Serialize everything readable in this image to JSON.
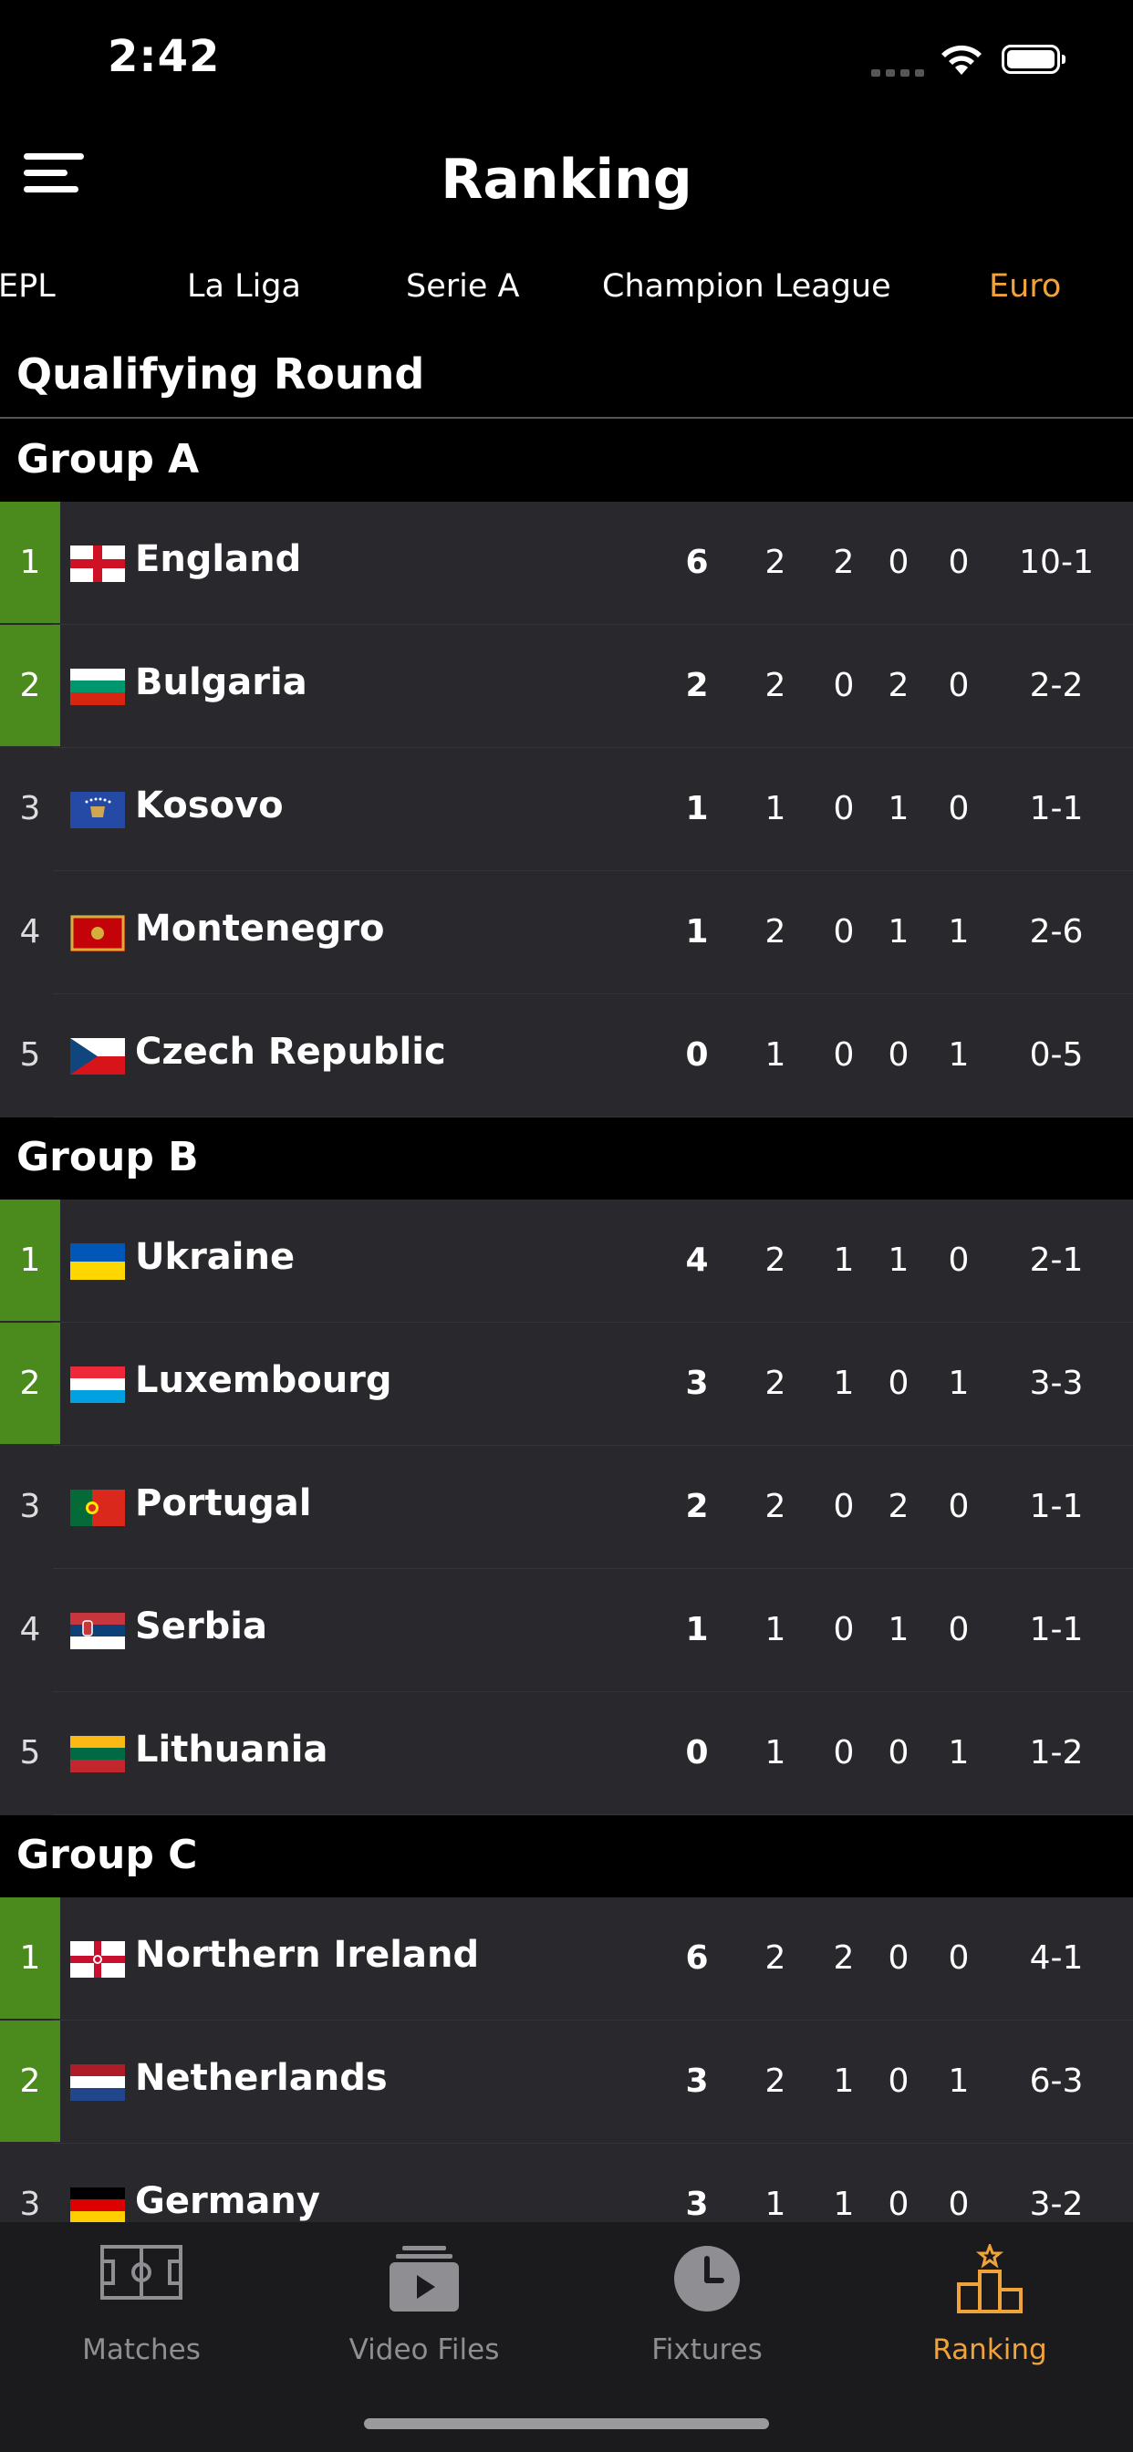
{
  "status": {
    "time": "2:42"
  },
  "header": {
    "title": "Ranking"
  },
  "tabs": [
    {
      "label": "EPL"
    },
    {
      "label": "La Liga"
    },
    {
      "label": "Serie A"
    },
    {
      "label": "Champion League"
    },
    {
      "label": "Euro",
      "active": true
    }
  ],
  "round": {
    "title": "Qualifying Round"
  },
  "colors": {
    "accent": "#f0a23b",
    "qualify": "#4b8a1c",
    "row_bg": "#28282d"
  },
  "groups": [
    {
      "name": "Group A",
      "rows": [
        {
          "rank": "1",
          "qualified": true,
          "flag": "england-flag-icon",
          "team": "England",
          "pts": "6",
          "p": "2",
          "w": "2",
          "d": "0",
          "l": "0",
          "goals": "10-1"
        },
        {
          "rank": "2",
          "qualified": true,
          "flag": "bulgaria-flag-icon",
          "team": "Bulgaria",
          "pts": "2",
          "p": "2",
          "w": "0",
          "d": "2",
          "l": "0",
          "goals": "2-2"
        },
        {
          "rank": "3",
          "qualified": false,
          "flag": "kosovo-flag-icon",
          "team": "Kosovo",
          "pts": "1",
          "p": "1",
          "w": "0",
          "d": "1",
          "l": "0",
          "goals": "1-1"
        },
        {
          "rank": "4",
          "qualified": false,
          "flag": "montenegro-flag-icon",
          "team": "Montenegro",
          "pts": "1",
          "p": "2",
          "w": "0",
          "d": "1",
          "l": "1",
          "goals": "2-6"
        },
        {
          "rank": "5",
          "qualified": false,
          "flag": "czech-republic-flag-icon",
          "team": "Czech Republic",
          "pts": "0",
          "p": "1",
          "w": "0",
          "d": "0",
          "l": "1",
          "goals": "0-5"
        }
      ]
    },
    {
      "name": "Group B",
      "rows": [
        {
          "rank": "1",
          "qualified": true,
          "flag": "ukraine-flag-icon",
          "team": "Ukraine",
          "pts": "4",
          "p": "2",
          "w": "1",
          "d": "1",
          "l": "0",
          "goals": "2-1"
        },
        {
          "rank": "2",
          "qualified": true,
          "flag": "luxembourg-flag-icon",
          "team": "Luxembourg",
          "pts": "3",
          "p": "2",
          "w": "1",
          "d": "0",
          "l": "1",
          "goals": "3-3"
        },
        {
          "rank": "3",
          "qualified": false,
          "flag": "portugal-flag-icon",
          "team": "Portugal",
          "pts": "2",
          "p": "2",
          "w": "0",
          "d": "2",
          "l": "0",
          "goals": "1-1"
        },
        {
          "rank": "4",
          "qualified": false,
          "flag": "serbia-flag-icon",
          "team": "Serbia",
          "pts": "1",
          "p": "1",
          "w": "0",
          "d": "1",
          "l": "0",
          "goals": "1-1"
        },
        {
          "rank": "5",
          "qualified": false,
          "flag": "lithuania-flag-icon",
          "team": "Lithuania",
          "pts": "0",
          "p": "1",
          "w": "0",
          "d": "0",
          "l": "1",
          "goals": "1-2"
        }
      ]
    },
    {
      "name": "Group C",
      "rows": [
        {
          "rank": "1",
          "qualified": true,
          "flag": "northern-ireland-flag-icon",
          "team": "Northern Ireland",
          "pts": "6",
          "p": "2",
          "w": "2",
          "d": "0",
          "l": "0",
          "goals": "4-1"
        },
        {
          "rank": "2",
          "qualified": true,
          "flag": "netherlands-flag-icon",
          "team": "Netherlands",
          "pts": "3",
          "p": "2",
          "w": "1",
          "d": "0",
          "l": "1",
          "goals": "6-3"
        },
        {
          "rank": "3",
          "qualified": false,
          "flag": "germany-flag-icon",
          "team": "Germany",
          "pts": "3",
          "p": "1",
          "w": "1",
          "d": "0",
          "l": "0",
          "goals": "3-2"
        }
      ]
    }
  ],
  "tabbar": [
    {
      "label": "Matches",
      "icon": "football-pitch-icon"
    },
    {
      "label": "Video Files",
      "icon": "video-files-icon"
    },
    {
      "label": "Fixtures",
      "icon": "clock-icon"
    },
    {
      "label": "Ranking",
      "icon": "podium-icon",
      "active": true
    }
  ]
}
